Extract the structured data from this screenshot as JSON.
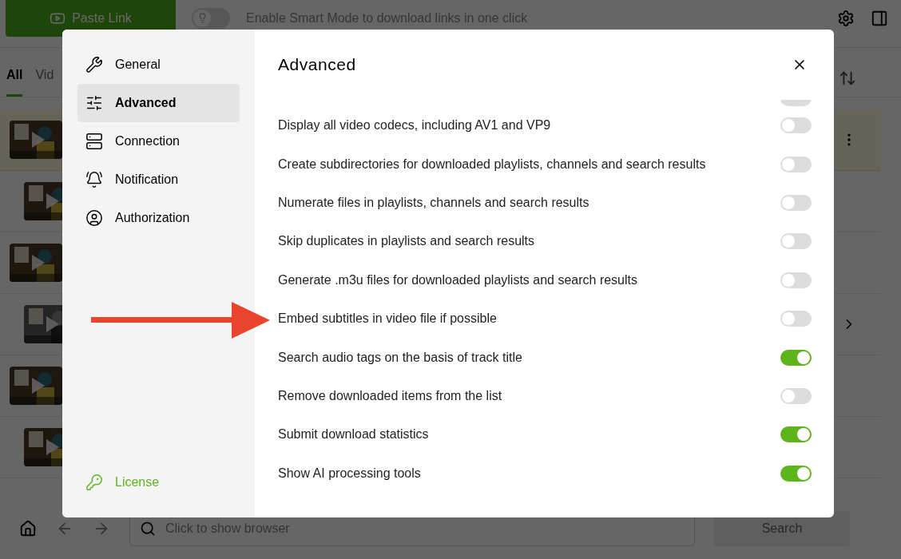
{
  "toolbar": {
    "paste_button": "Paste Link",
    "smart_mode": {
      "on": false,
      "label": "Enable Smart Mode to download links in one click"
    }
  },
  "filter_tabs": [
    {
      "label": "All",
      "selected": true
    },
    {
      "label": "Vid",
      "selected": false
    }
  ],
  "downloads": [
    {
      "kind": "video",
      "selected": true
    },
    {
      "kind": "video",
      "selected": false
    },
    {
      "kind": "video",
      "selected": false
    },
    {
      "kind": "playlist",
      "selected": false
    },
    {
      "kind": "video",
      "selected": false
    },
    {
      "kind": "video",
      "selected": false
    }
  ],
  "bottom_bar": {
    "search": {
      "placeholder": "Click to show browser"
    },
    "search_button": "Search"
  },
  "settings_dialog": {
    "title": "Advanced",
    "nav": [
      {
        "label": "General",
        "selected": false
      },
      {
        "label": "Advanced",
        "selected": true
      },
      {
        "label": "Connection",
        "selected": false
      },
      {
        "label": "Notification",
        "selected": false
      },
      {
        "label": "Authorization",
        "selected": false
      }
    ],
    "license": "License",
    "option_above": {
      "on": false
    },
    "options": [
      {
        "label": "Display all video codecs, including AV1 and VP9",
        "on": false
      },
      {
        "label": "Create subdirectories for downloaded playlists, channels and search results",
        "on": false
      },
      {
        "label": "Numerate files in playlists, channels and search results",
        "on": false
      },
      {
        "label": "Skip duplicates in playlists and search results",
        "on": false
      },
      {
        "label": "Generate .m3u files for downloaded playlists and search results",
        "on": false
      },
      {
        "label": "Embed subtitles in video file if possible",
        "on": false
      },
      {
        "label": "Search audio tags on the basis of track title",
        "on": true
      },
      {
        "label": "Remove downloaded items from the list",
        "on": false
      },
      {
        "label": "Submit download statistics",
        "on": true
      },
      {
        "label": "Show AI processing tools",
        "on": true
      }
    ]
  }
}
